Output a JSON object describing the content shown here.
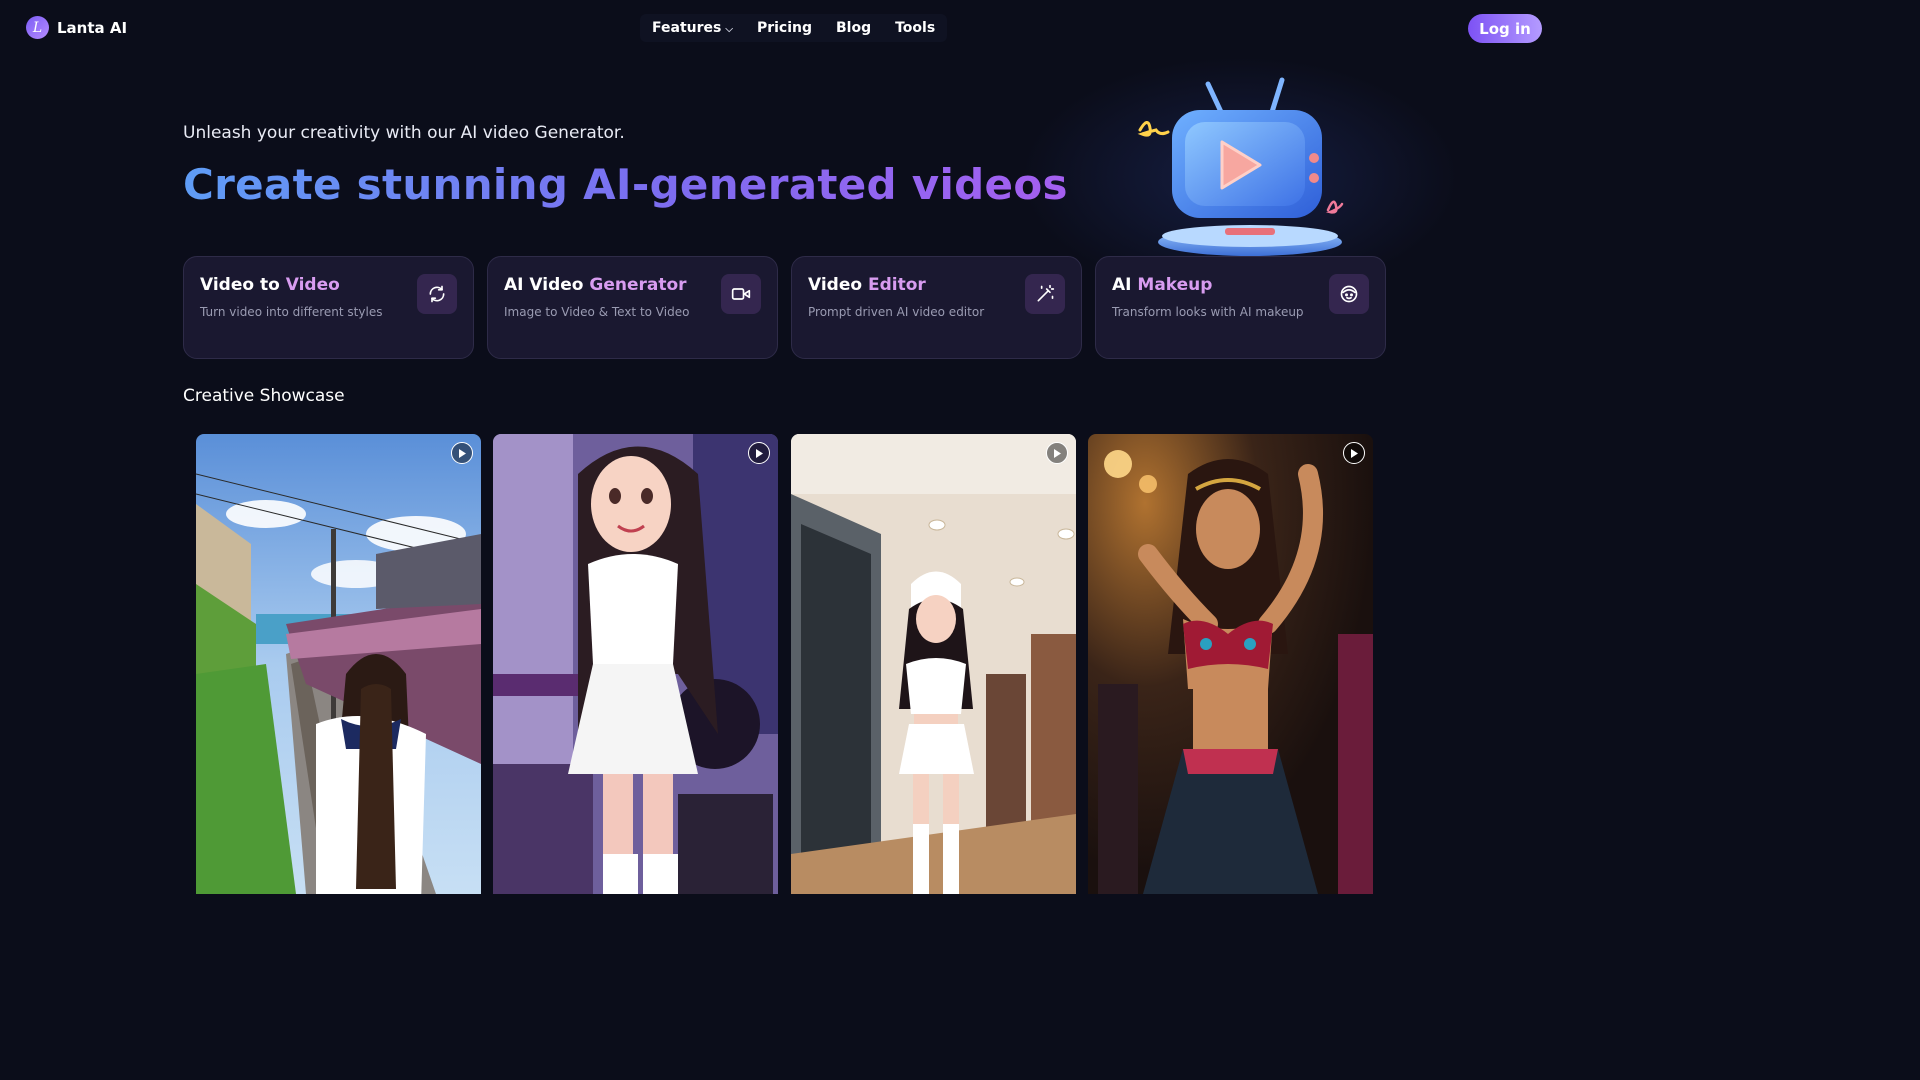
{
  "brand": {
    "name": "Lanta AI",
    "logo_letter": "L"
  },
  "nav": {
    "items": [
      {
        "label": "Features",
        "has_dropdown": true
      },
      {
        "label": "Pricing"
      },
      {
        "label": "Blog"
      },
      {
        "label": "Tools"
      }
    ],
    "login_label": "Log in"
  },
  "hero": {
    "tagline": "Unleash your creativity with our AI video Generator.",
    "headline": "Create stunning AI-generated videos"
  },
  "cards": [
    {
      "title_main": "Video to ",
      "title_accent": "Video",
      "subtitle": "Turn video into different styles",
      "icon": "refresh-icon"
    },
    {
      "title_main": "AI Video ",
      "title_accent": "Generator",
      "subtitle": "Image to Video & Text to Video",
      "icon": "video-camera-icon"
    },
    {
      "title_main": "Video ",
      "title_accent": "Editor",
      "subtitle": "Prompt driven AI video editor",
      "icon": "magic-wand-icon"
    },
    {
      "title_main": "AI ",
      "title_accent": "Makeup",
      "subtitle": "Transform looks with AI makeup",
      "icon": "face-icon"
    }
  ],
  "showcase": {
    "title": "Creative Showcase",
    "tiles": [
      {
        "description": "anime-railway"
      },
      {
        "description": "anime-girl-purple"
      },
      {
        "description": "anime-maid-room"
      },
      {
        "description": "dancer"
      }
    ]
  },
  "colors": {
    "background": "#0b0d1a",
    "accent_purple": "#7d52f4",
    "card_bg": "#1a1830",
    "title_accent": "#d89cf0"
  }
}
